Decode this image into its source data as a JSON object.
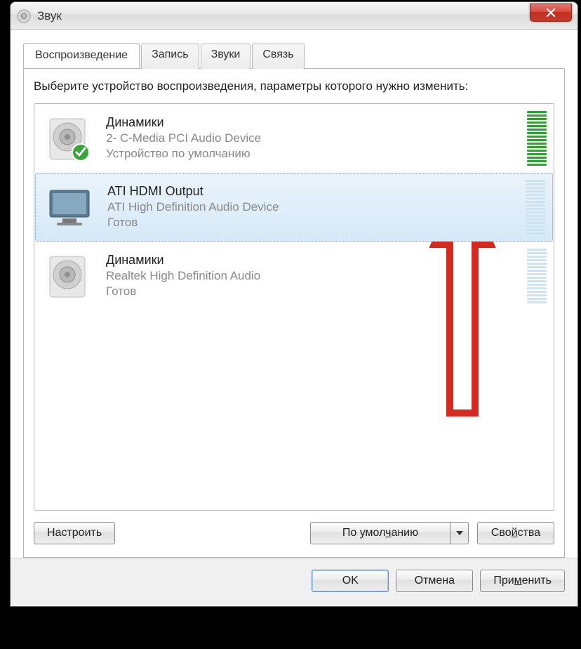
{
  "window": {
    "title": "Звук"
  },
  "tabs": [
    {
      "label": "Воспроизведение",
      "active": true
    },
    {
      "label": "Запись",
      "active": false
    },
    {
      "label": "Звуки",
      "active": false
    },
    {
      "label": "Связь",
      "active": false
    }
  ],
  "instruction": "Выберите устройство воспроизведения, параметры которого нужно изменить:",
  "devices": [
    {
      "name": "Динамики",
      "desc": "2- C-Media PCI Audio Device",
      "status": "Устройство по умолчанию",
      "icon": "speaker",
      "default": true,
      "selected": false,
      "meter_color": "green",
      "meter_level": 16
    },
    {
      "name": "ATI HDMI Output",
      "desc": "ATI High Definition Audio Device",
      "status": "Готов",
      "icon": "monitor",
      "default": false,
      "selected": true,
      "meter_color": "blue",
      "meter_level": 0
    },
    {
      "name": "Динамики",
      "desc": "Realtek High Definition Audio",
      "status": "Готов",
      "icon": "speaker",
      "default": false,
      "selected": false,
      "meter_color": "blue",
      "meter_level": 0
    }
  ],
  "panel_buttons": {
    "configure": "Настроить",
    "set_default": "По умолчанию",
    "properties": "Свойства"
  },
  "footer_buttons": {
    "ok": "OK",
    "cancel": "Отмена",
    "apply": "Применить"
  },
  "colors": {
    "meter_green_on": "#2ea12e",
    "meter_green_off": "#bfe6bf",
    "meter_blue_off": "#cfe3ef"
  }
}
